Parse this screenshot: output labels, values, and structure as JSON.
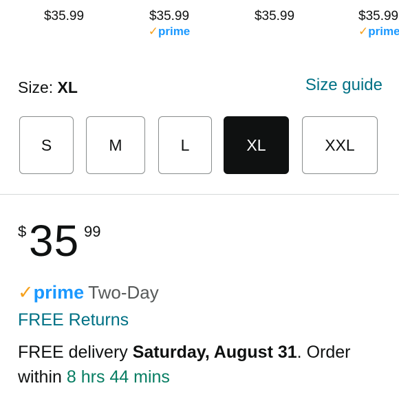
{
  "variant_prices": [
    {
      "price": "$35.99",
      "prime": false
    },
    {
      "price": "$35.99",
      "prime": true,
      "prime_label": "prime"
    },
    {
      "price": "$35.99",
      "prime": false
    },
    {
      "price": "$35.99",
      "prime": true,
      "prime_label": "prime"
    }
  ],
  "size": {
    "label": "Size: ",
    "selected": "XL",
    "guide_label": "Size guide",
    "options": [
      "S",
      "M",
      "L",
      "XL",
      "XXL"
    ]
  },
  "price": {
    "symbol": "$",
    "whole": "35",
    "fraction": "99"
  },
  "prime_delivery": {
    "check": "✓",
    "prime_word": "prime",
    "speed": "Two-Day"
  },
  "returns": {
    "label": "FREE Returns"
  },
  "delivery": {
    "prefix": "FREE delivery ",
    "date": "Saturday, August 31",
    "middle": ". Order within ",
    "countdown": "8 hrs 44 mins"
  },
  "colors": {
    "link_teal": "#007185",
    "prime_blue": "#1a98ff",
    "prime_check_orange": "#f6a01a",
    "countdown_green": "#067d62",
    "selected_button_bg": "#0f1111"
  }
}
